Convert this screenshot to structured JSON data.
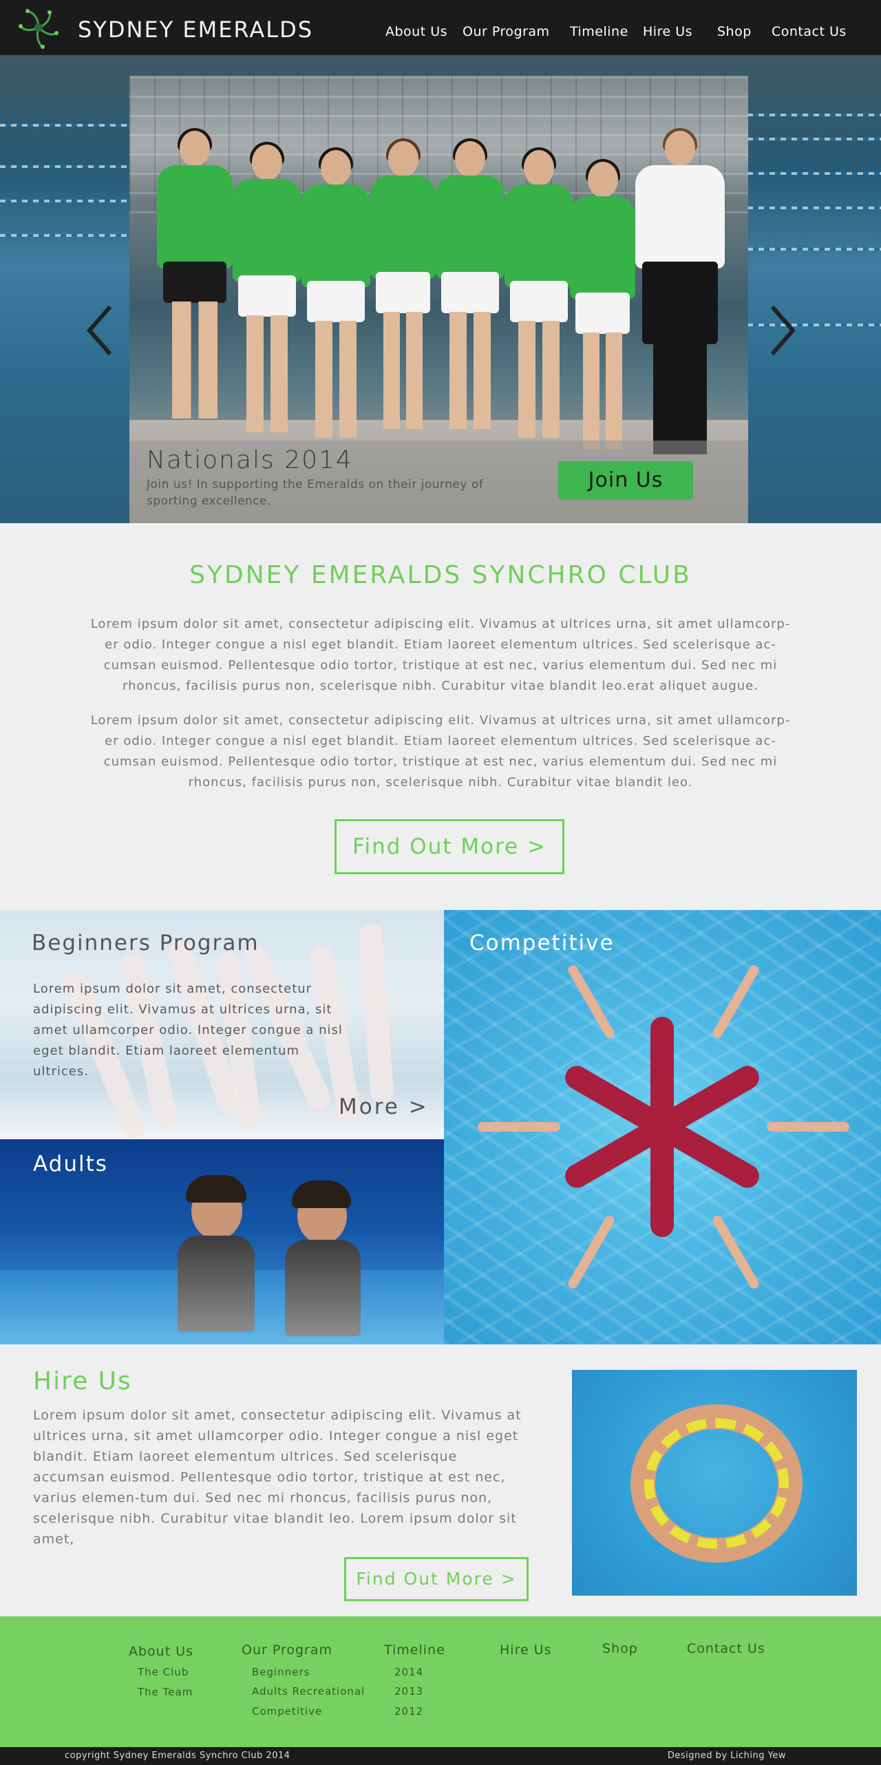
{
  "header": {
    "brand": "SYDNEY EMERALDS",
    "nav": [
      "About Us",
      "Our Program",
      "Timeline",
      "Hire Us",
      "Shop",
      "Contact Us"
    ]
  },
  "hero": {
    "title": "Nationals 2014",
    "text": "Join us! In supporting the Emeralds on their journey of sporting excellence.",
    "button": "Join Us"
  },
  "intro": {
    "title": "SYDNEY EMERALDS SYNCHRO CLUB",
    "paragraph1": "Lorem ipsum dolor sit amet, consectetur adipiscing elit. Vivamus at ultrices urna, sit amet ullamcorp-er odio. Integer congue a nisl eget blandit. Etiam laoreet elementum ultrices. Sed scelerisque ac-cumsan euismod. Pellentesque odio tortor, tristique at est nec, varius elementum dui. Sed nec mi rhoncus, facilisis purus non, scelerisque nibh. Curabitur vitae blandit leo.erat aliquet augue.",
    "paragraph2": "Lorem ipsum dolor sit amet, consectetur adipiscing elit. Vivamus at ultrices urna, sit amet ullamcorp-er odio. Integer congue a nisl eget blandit. Etiam laoreet elementum ultrices. Sed scelerisque ac-cumsan euismod. Pellentesque odio tortor, tristique at est nec, varius elementum dui. Sed nec mi rhoncus, facilisis purus non, scelerisque nibh. Curabitur vitae blandit leo.",
    "button": "Find Out More >"
  },
  "programs": {
    "beginners": {
      "title": "Beginners Program",
      "text": "Lorem ipsum dolor sit amet, consectetur adipiscing elit. Vivamus at ultrices urna, sit amet ullamcorper odio. Integer congue a nisl eget blandit. Etiam laoreet elementum ultrices.",
      "more": "More >"
    },
    "competitive": {
      "title": "Competitive"
    },
    "adults": {
      "title": "Adults"
    }
  },
  "hire": {
    "title": "Hire Us",
    "text": "Lorem ipsum dolor sit amet, consectetur adipiscing elit. Vivamus at ultrices urna, sit amet ullamcorper odio. Integer congue a nisl eget blandit. Etiam laoreet elementum ultrices. Sed scelerisque accumsan euismod. Pellentesque odio tortor, tristique at est nec, varius elemen-tum dui. Sed nec mi rhoncus, facilisis purus non, scelerisque nibh. Curabitur vitae blandit leo. Lorem ipsum dolor sit amet,",
    "button": "Find Out More >"
  },
  "footer": {
    "columns": [
      {
        "heading": "About Us",
        "items": [
          "The Club",
          "The Team"
        ]
      },
      {
        "heading": "Our Program",
        "items": [
          "Beginners",
          "Adults Recreational",
          "Competitive"
        ]
      },
      {
        "heading": "Timeline",
        "items": [
          "2014",
          "2013",
          "2012"
        ]
      },
      {
        "heading": "Hire Us",
        "items": []
      },
      {
        "heading": "Shop",
        "items": []
      },
      {
        "heading": "Contact Us",
        "items": []
      }
    ],
    "copyright": "copyright  Sydney Emeralds Synchro Club 2014",
    "designer": "Designed by Liching Yew"
  },
  "colors": {
    "accent": "#6fd05a",
    "header_bg": "#1b1b1b",
    "footer_bg": "#77d160",
    "join_button": "#3fb54f"
  },
  "icons": [
    "club-logo-icon",
    "chevron-left-icon",
    "chevron-right-icon"
  ]
}
